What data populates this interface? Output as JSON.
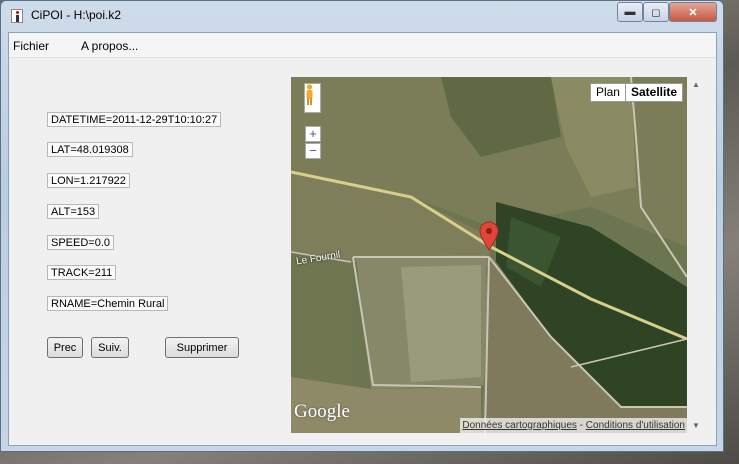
{
  "window": {
    "title": "CiPOI - H:\\poi.k2"
  },
  "controls": {
    "minimize": "▬",
    "maximize": "◻",
    "close": "✕"
  },
  "menu": {
    "items": [
      "Fichier",
      "A propos..."
    ]
  },
  "fields": {
    "datetime": "DATETIME=2011-12-29T10:10:27",
    "lat": "LAT=48.019308",
    "lon": "LON=1.217922",
    "alt": "ALT=153",
    "speed": "SPEED=0.0",
    "track": "TRACK=211",
    "rname": "RNAME=Chemin Rural"
  },
  "buttons": {
    "prev": "Prec",
    "next": "Suiv.",
    "delete": "Supprimer"
  },
  "map": {
    "type_plan": "Plan",
    "type_satellite": "Satellite",
    "zoom_in": "+",
    "zoom_out": "−",
    "road_label": "Le Fournil",
    "logo": "Google",
    "attribution_data": "Données cartographiques",
    "attribution_sep": " - ",
    "attribution_terms": "Conditions d'utilisation",
    "marker_color": "#e0453a"
  },
  "scroll": {
    "up": "▲",
    "down": "▼"
  }
}
